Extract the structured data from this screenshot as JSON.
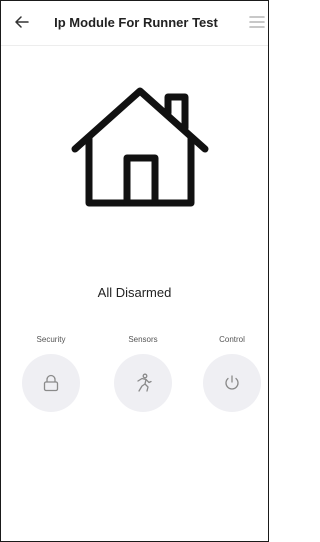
{
  "header": {
    "title": "Ip Module For Runner Test",
    "back_icon": "arrow-left-icon",
    "menu_icon": "menu-icon"
  },
  "hero": {
    "icon": "house-icon",
    "status": "All Disarmed"
  },
  "controls": [
    {
      "label": "Security",
      "icon": "lock-icon"
    },
    {
      "label": "Sensors",
      "icon": "running-person-icon"
    },
    {
      "label": "Control",
      "icon": "power-icon"
    }
  ],
  "colors": {
    "text": "#222222",
    "button_bg": "#efeff3",
    "icon_gray": "#888888"
  }
}
